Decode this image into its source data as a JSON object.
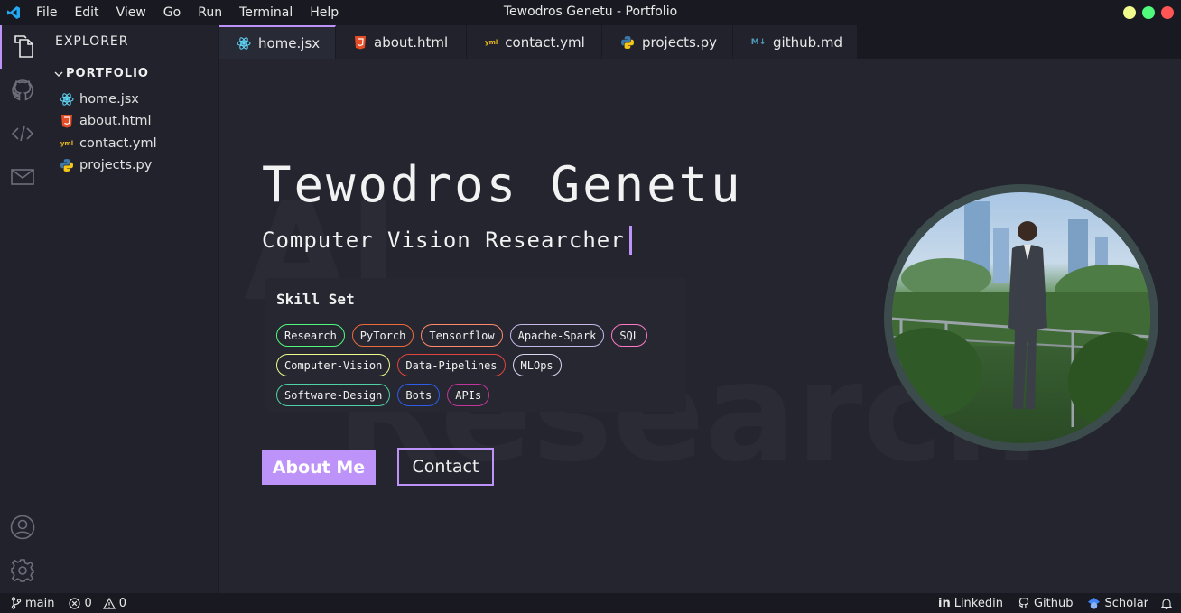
{
  "menu": [
    "File",
    "Edit",
    "View",
    "Go",
    "Run",
    "Terminal",
    "Help"
  ],
  "window_title": "Tewodros Genetu - Portfolio",
  "window_buttons": {
    "minimize": "#f1fa8c",
    "maximize": "#50fa7b",
    "close": "#ff5555"
  },
  "sidebar": {
    "title": "EXPLORER",
    "folder": "PORTFOLIO",
    "files": [
      {
        "name": "home.jsx",
        "icon": "react-icon"
      },
      {
        "name": "about.html",
        "icon": "html-icon"
      },
      {
        "name": "contact.yml",
        "icon": "yaml-icon"
      },
      {
        "name": "projects.py",
        "icon": "python-icon"
      }
    ]
  },
  "tabs": [
    {
      "label": "home.jsx",
      "icon": "react-icon",
      "active": true
    },
    {
      "label": "about.html",
      "icon": "html-icon"
    },
    {
      "label": "contact.yml",
      "icon": "yaml-icon"
    },
    {
      "label": "projects.py",
      "icon": "python-icon"
    },
    {
      "label": "github.md",
      "icon": "markdown-icon"
    }
  ],
  "hero": {
    "name": "Tewodros Genetu",
    "role": "Computer Vision Researcher",
    "background_words": [
      "AI",
      "Research"
    ],
    "skills_title": "Skill Set",
    "skills": [
      {
        "label": "Research",
        "color": "#50fa7b"
      },
      {
        "label": "PyTorch",
        "color": "#ee6a3a"
      },
      {
        "label": "Tensorflow",
        "color": "#ff8a6a"
      },
      {
        "label": "Apache-Spark",
        "color": "#c4b8e8"
      },
      {
        "label": "SQL",
        "color": "#ff79c6"
      },
      {
        "label": "Computer-Vision",
        "color": "#f1fa8c"
      },
      {
        "label": "Data-Pipelines",
        "color": "#e0443c"
      },
      {
        "label": "MLOps",
        "color": "#d8d8f0"
      },
      {
        "label": "Software-Design",
        "color": "#4fd1a5"
      },
      {
        "label": "Bots",
        "color": "#2e5de8"
      },
      {
        "label": "APIs",
        "color": "#c0369a"
      }
    ],
    "about_button": "About Me",
    "contact_button": "Contact",
    "accent": "#bd93f9"
  },
  "status": {
    "branch": "main",
    "errors": "0",
    "warnings": "0",
    "links": [
      "Linkedin",
      "Github",
      "Scholar"
    ]
  }
}
